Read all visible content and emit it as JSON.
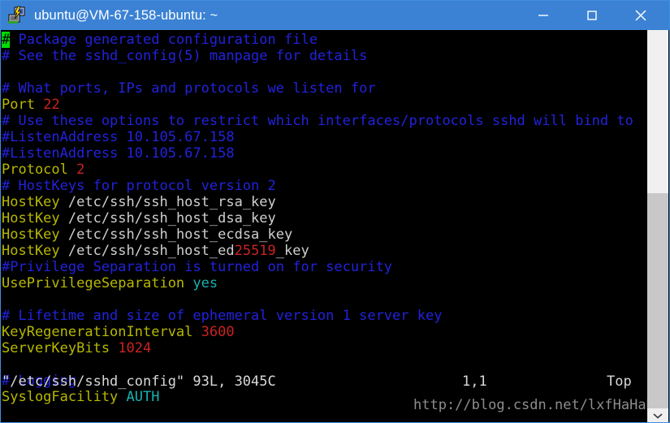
{
  "window": {
    "title": "ubuntu@VM-67-158-ubuntu: ~",
    "app_icon": "putty-icon",
    "titlebar_color": "#3b82d4",
    "controls": {
      "minimize": "—",
      "maximize": "☐",
      "close": "✕"
    }
  },
  "terminal": {
    "background": "#000000",
    "cursor_char": "#",
    "cursor_color": "#00dd00",
    "colors": {
      "comment": "#2222dd",
      "keyword": "#b8b800",
      "number": "#cc2222",
      "path": "#cfcfcf",
      "cyan": "#18b2b2",
      "white": "#d8d8d8"
    },
    "lines": [
      [
        {
          "t": "#",
          "c": "cursor"
        },
        {
          "t": " Package generated configuration file",
          "c": "c-comment"
        }
      ],
      [
        {
          "t": "# See the sshd_config(5) manpage for details",
          "c": "c-comment"
        }
      ],
      [],
      [
        {
          "t": "# What ports, IPs and protocols we listen for",
          "c": "c-comment"
        }
      ],
      [
        {
          "t": "Port",
          "c": "c-key"
        },
        {
          "t": " ",
          "c": "c-white"
        },
        {
          "t": "22",
          "c": "c-val"
        }
      ],
      [
        {
          "t": "# Use these options to restrict which interfaces/protocols sshd will bind to",
          "c": "c-comment"
        }
      ],
      [
        {
          "t": "#ListenAddress 10.105.67.158",
          "c": "c-comment"
        }
      ],
      [
        {
          "t": "#ListenAddress 10.105.67.158",
          "c": "c-comment"
        }
      ],
      [
        {
          "t": "Protocol",
          "c": "c-key"
        },
        {
          "t": " ",
          "c": "c-white"
        },
        {
          "t": "2",
          "c": "c-val"
        }
      ],
      [
        {
          "t": "# HostKeys for protocol version 2",
          "c": "c-comment"
        }
      ],
      [
        {
          "t": "HostKey",
          "c": "c-key"
        },
        {
          "t": " /etc/ssh/ssh_host_rsa_key",
          "c": "c-path"
        }
      ],
      [
        {
          "t": "HostKey",
          "c": "c-key"
        },
        {
          "t": " /etc/ssh/ssh_host_dsa_key",
          "c": "c-path"
        }
      ],
      [
        {
          "t": "HostKey",
          "c": "c-key"
        },
        {
          "t": " /etc/ssh/ssh_host_ecdsa_key",
          "c": "c-path"
        }
      ],
      [
        {
          "t": "HostKey",
          "c": "c-key"
        },
        {
          "t": " /etc/ssh/ssh_host_ed",
          "c": "c-path"
        },
        {
          "t": "25519",
          "c": "c-val"
        },
        {
          "t": "_key",
          "c": "c-path"
        }
      ],
      [
        {
          "t": "#Privilege Separation is turned on for security",
          "c": "c-comment"
        }
      ],
      [
        {
          "t": "UsePrivilegeSeparation",
          "c": "c-key"
        },
        {
          "t": " ",
          "c": "c-white"
        },
        {
          "t": "yes",
          "c": "c-cyan"
        }
      ],
      [],
      [
        {
          "t": "# Lifetime and size of ephemeral version 1 server key",
          "c": "c-comment"
        }
      ],
      [
        {
          "t": "KeyRegenerationInterval",
          "c": "c-key"
        },
        {
          "t": " ",
          "c": "c-white"
        },
        {
          "t": "3600",
          "c": "c-val"
        }
      ],
      [
        {
          "t": "ServerKeyBits",
          "c": "c-key"
        },
        {
          "t": " ",
          "c": "c-white"
        },
        {
          "t": "1024",
          "c": "c-val"
        }
      ],
      [],
      [
        {
          "t": "# Logging",
          "c": "c-comment"
        }
      ],
      [
        {
          "t": "SyslogFacility",
          "c": "c-key"
        },
        {
          "t": " ",
          "c": "c-white"
        },
        {
          "t": "AUTH",
          "c": "c-cyan"
        }
      ]
    ]
  },
  "status": {
    "file_message": "\"/etc/ssh/sshd_config\" 93L, 3045C",
    "ruler": "1,1",
    "position": "Top"
  },
  "watermark": {
    "text": "http://blog.csdn.net/lxfHaHaHa",
    "color": "#8d8d8d"
  },
  "scrollbar": {
    "up_arrow": "⌃",
    "down_arrow": "⌄",
    "thumb_color": "#f0f0f0",
    "track_color": "#c8c8c8"
  }
}
